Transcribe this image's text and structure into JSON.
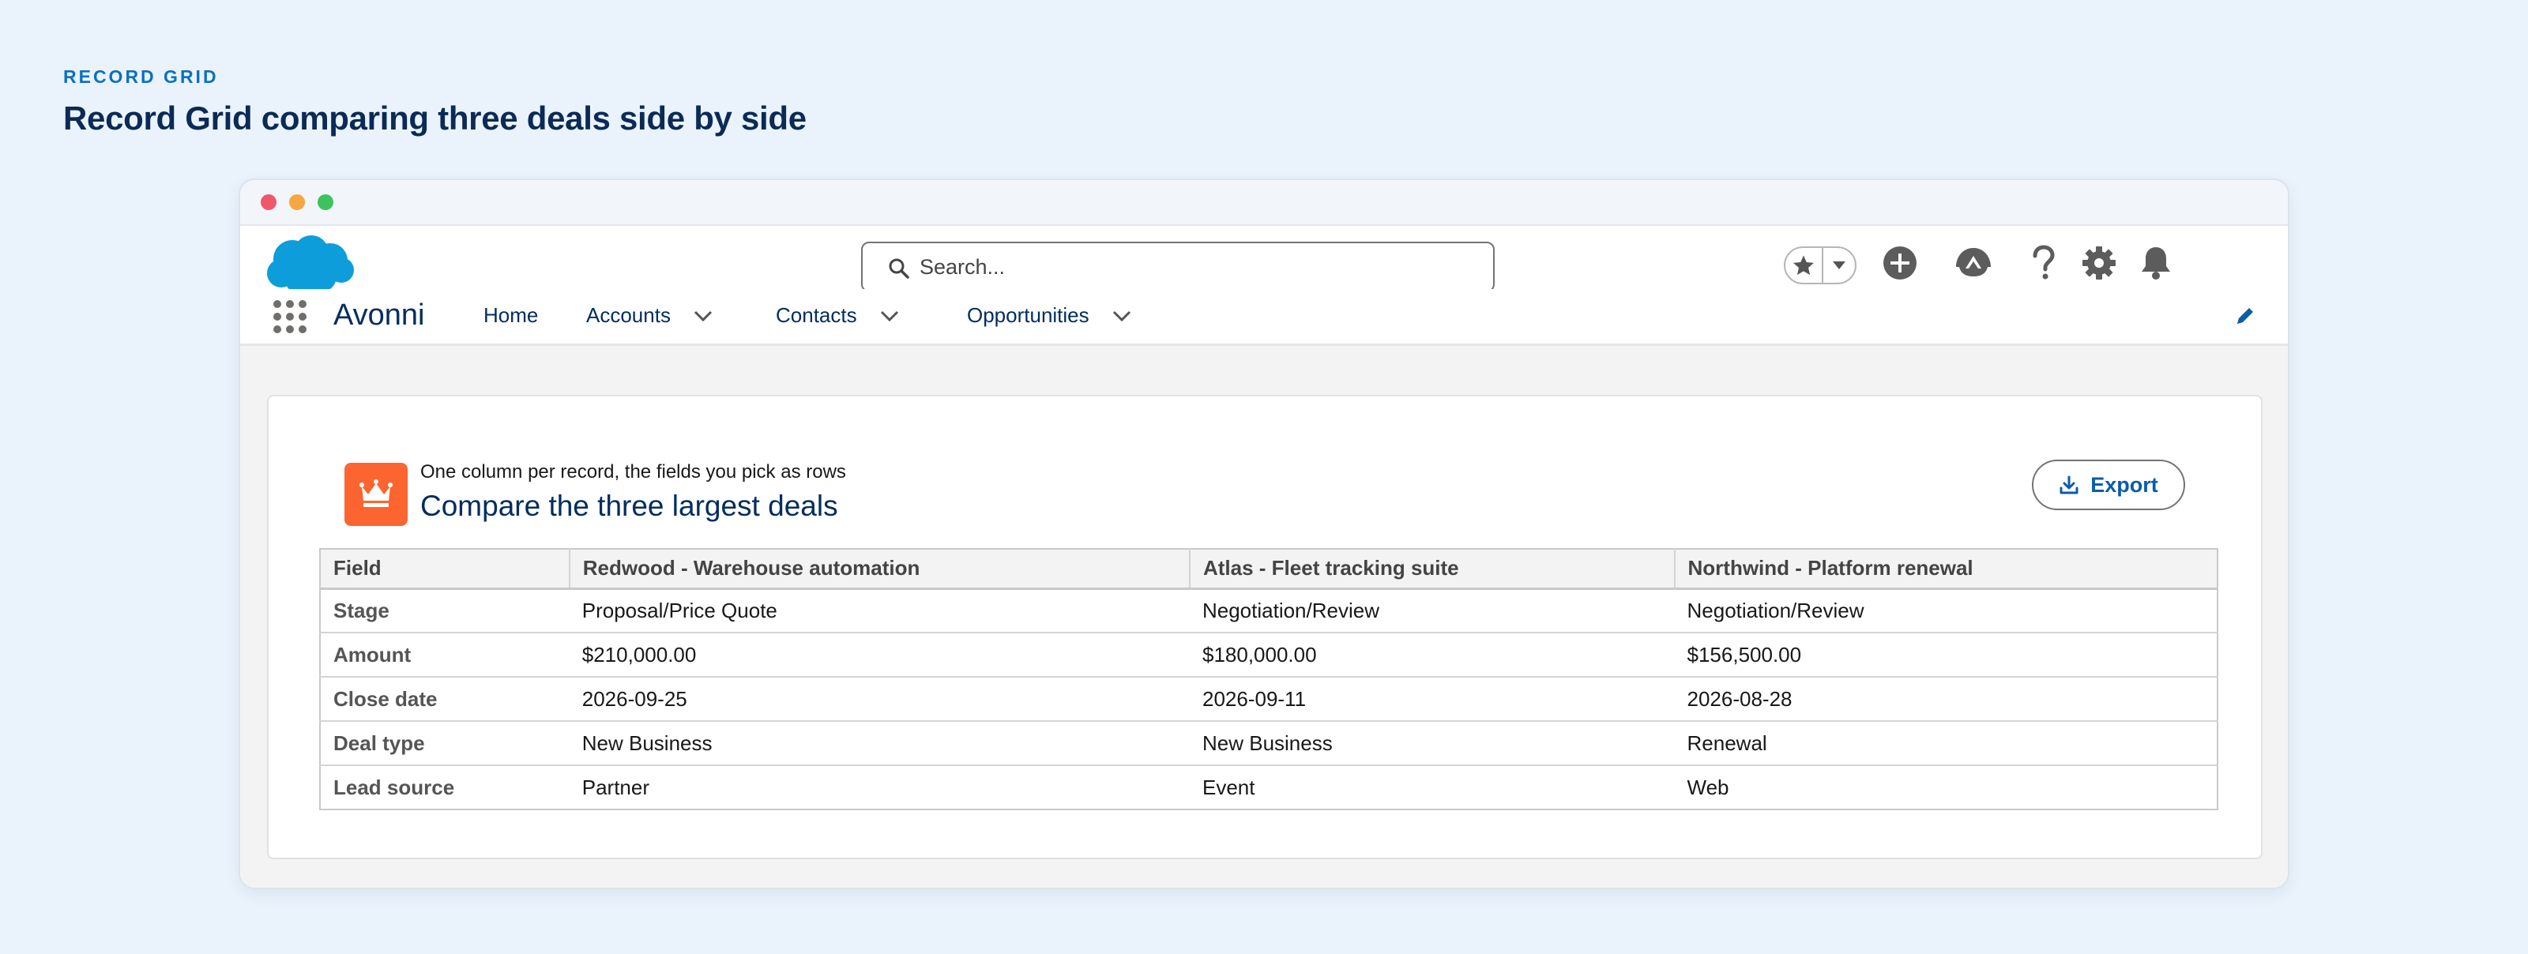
{
  "page": {
    "eyebrow": "RECORD GRID",
    "headline": "Record Grid comparing three deals side by side"
  },
  "header": {
    "logo_icon": "salesforce-cloud-logo",
    "search_placeholder": "Search...",
    "icons": [
      "favorites-star-icon",
      "favorites-dropdown-icon",
      "add-icon",
      "trailhead-icon",
      "help-icon",
      "setup-gear-icon",
      "notifications-bell-icon"
    ]
  },
  "nav": {
    "app_name": "Avonni",
    "items": [
      {
        "label": "Home",
        "has_menu": false
      },
      {
        "label": "Accounts",
        "has_menu": true
      },
      {
        "label": "Contacts",
        "has_menu": true
      },
      {
        "label": "Opportunities",
        "has_menu": true
      }
    ]
  },
  "card": {
    "icon": "crown-icon",
    "icon_color": "#fd6530",
    "subtitle": "One column per record, the fields you pick as rows",
    "title": "Compare the three largest deals",
    "export_label": "Export"
  },
  "grid": {
    "headers": [
      "Field",
      "Redwood - Warehouse automation",
      "Atlas - Fleet tracking suite",
      "Northwind - Platform renewal"
    ],
    "rows": [
      {
        "field": "Stage",
        "values": [
          "Proposal/Price Quote",
          "Negotiation/Review",
          "Negotiation/Review"
        ]
      },
      {
        "field": "Amount",
        "values": [
          "$210,000.00",
          "$180,000.00",
          "$156,500.00"
        ]
      },
      {
        "field": "Close date",
        "values": [
          "2026-09-25",
          "2026-09-11",
          "2026-08-28"
        ]
      },
      {
        "field": "Deal type",
        "values": [
          "New Business",
          "New Business",
          "Renewal"
        ]
      },
      {
        "field": "Lead source",
        "values": [
          "Partner",
          "Event",
          "Web"
        ]
      }
    ]
  },
  "colors": {
    "brand_blue": "#0b5cab",
    "navy": "#032d60",
    "accent_orange": "#fd6530"
  }
}
